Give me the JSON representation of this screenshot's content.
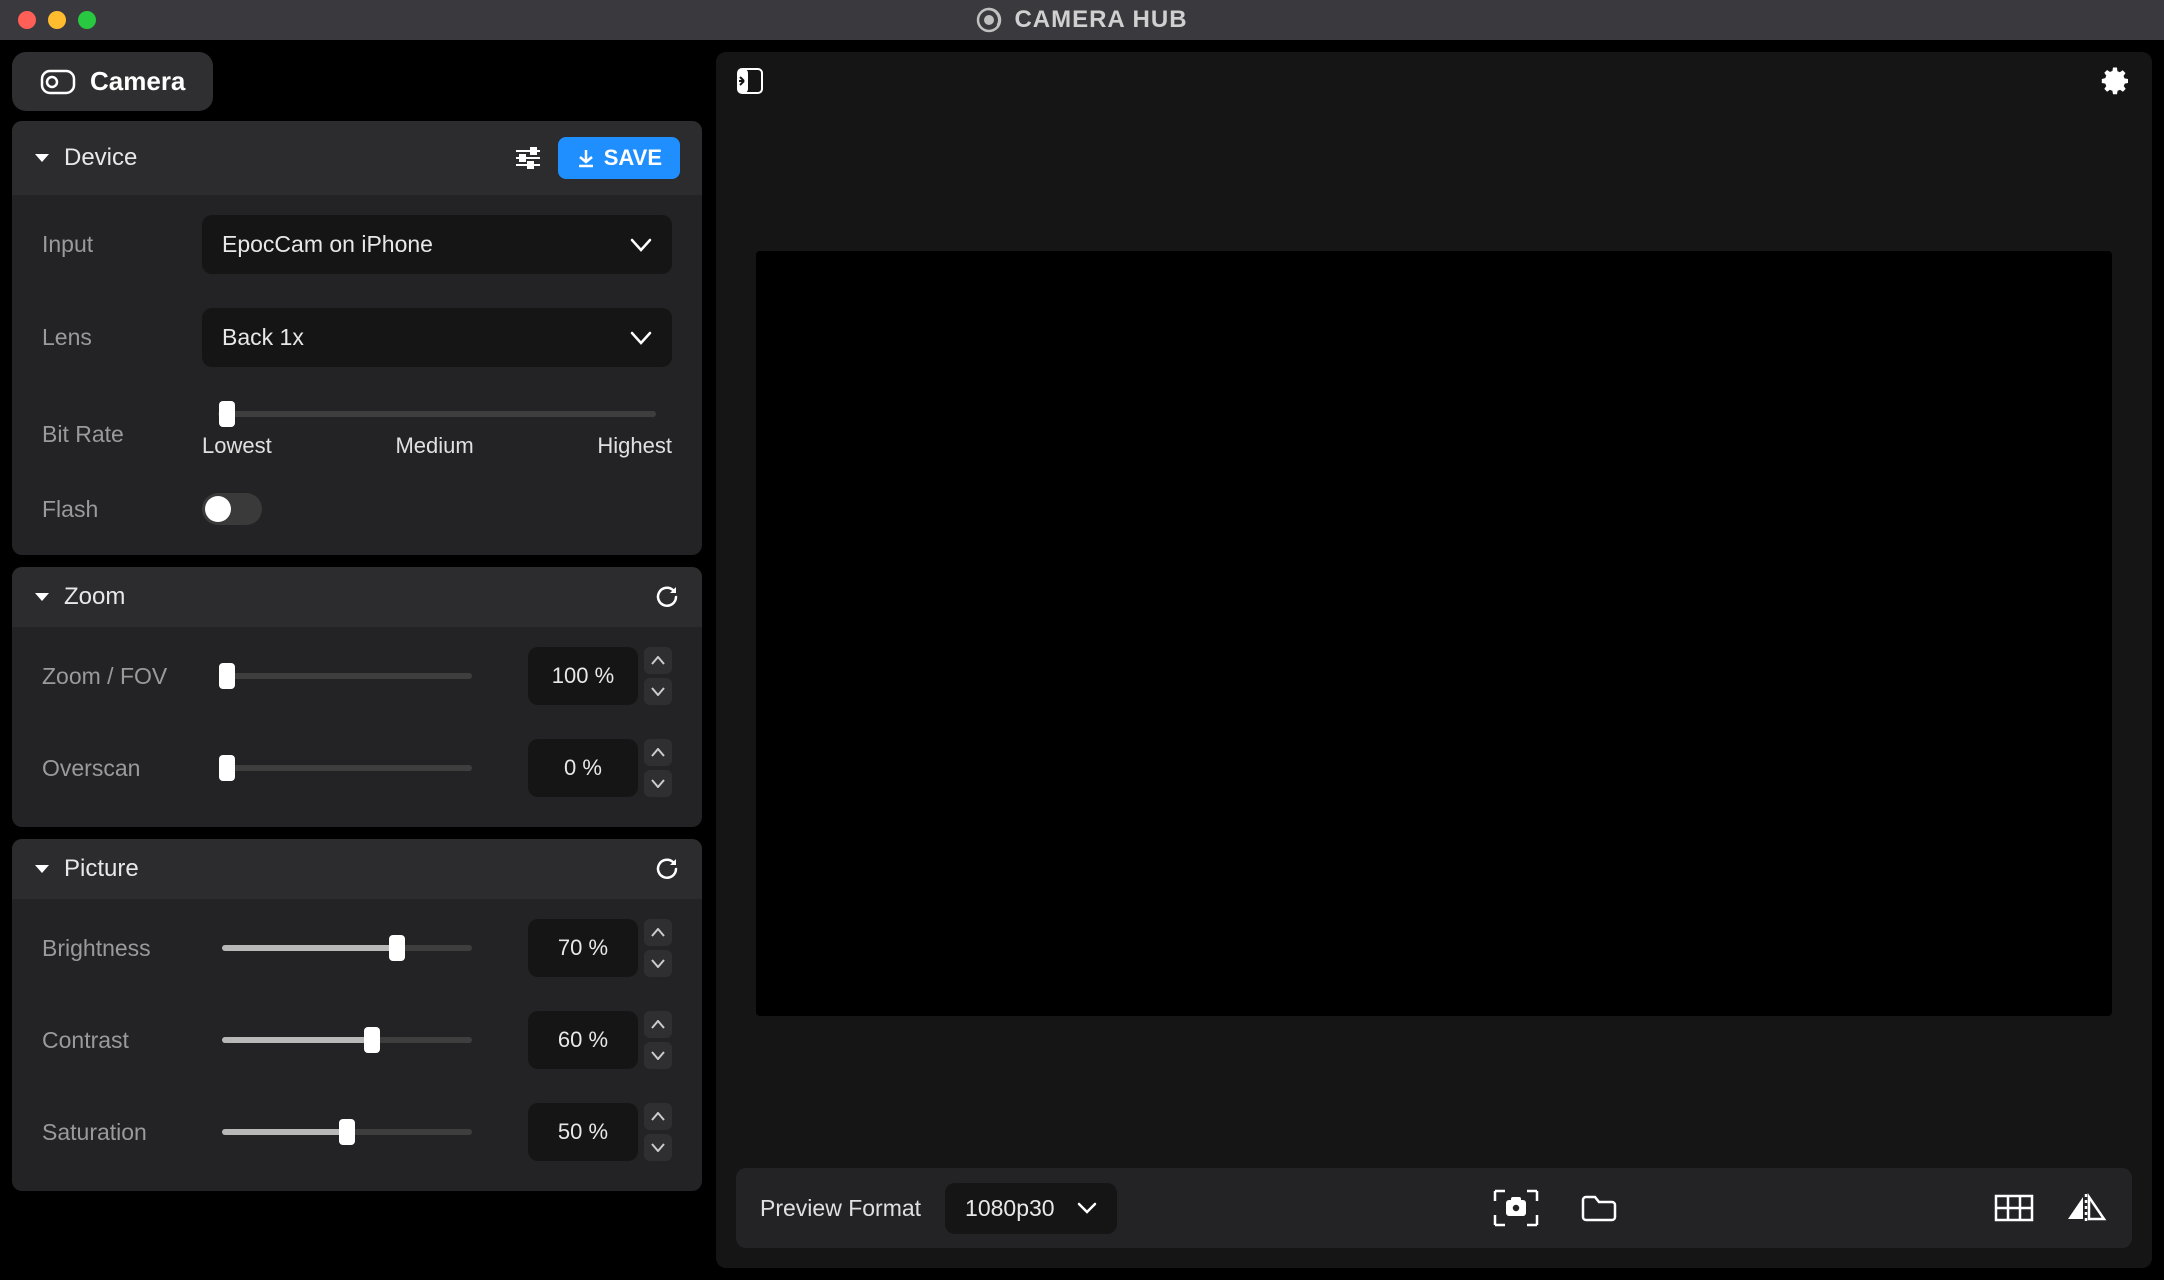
{
  "title": "CAMERA HUB",
  "mode_label": "Camera",
  "device": {
    "header": "Device",
    "save_label": "SAVE",
    "input_label": "Input",
    "input_value": "EpocCam on iPhone",
    "lens_label": "Lens",
    "lens_value": "Back 1x",
    "bitrate_label": "Bit Rate",
    "bitrate_lowest": "Lowest",
    "bitrate_medium": "Medium",
    "bitrate_highest": "Highest",
    "flash_label": "Flash"
  },
  "zoom": {
    "header": "Zoom",
    "zoom_label": "Zoom / FOV",
    "zoom_value": "100 %",
    "overscan_label": "Overscan",
    "overscan_value": "0 %"
  },
  "picture": {
    "header": "Picture",
    "brightness_label": "Brightness",
    "brightness_value": "70 %",
    "contrast_label": "Contrast",
    "contrast_value": "60 %",
    "saturation_label": "Saturation",
    "saturation_value": "50 %"
  },
  "bottom": {
    "preview_format_label": "Preview Format",
    "preview_format_value": "1080p30"
  }
}
